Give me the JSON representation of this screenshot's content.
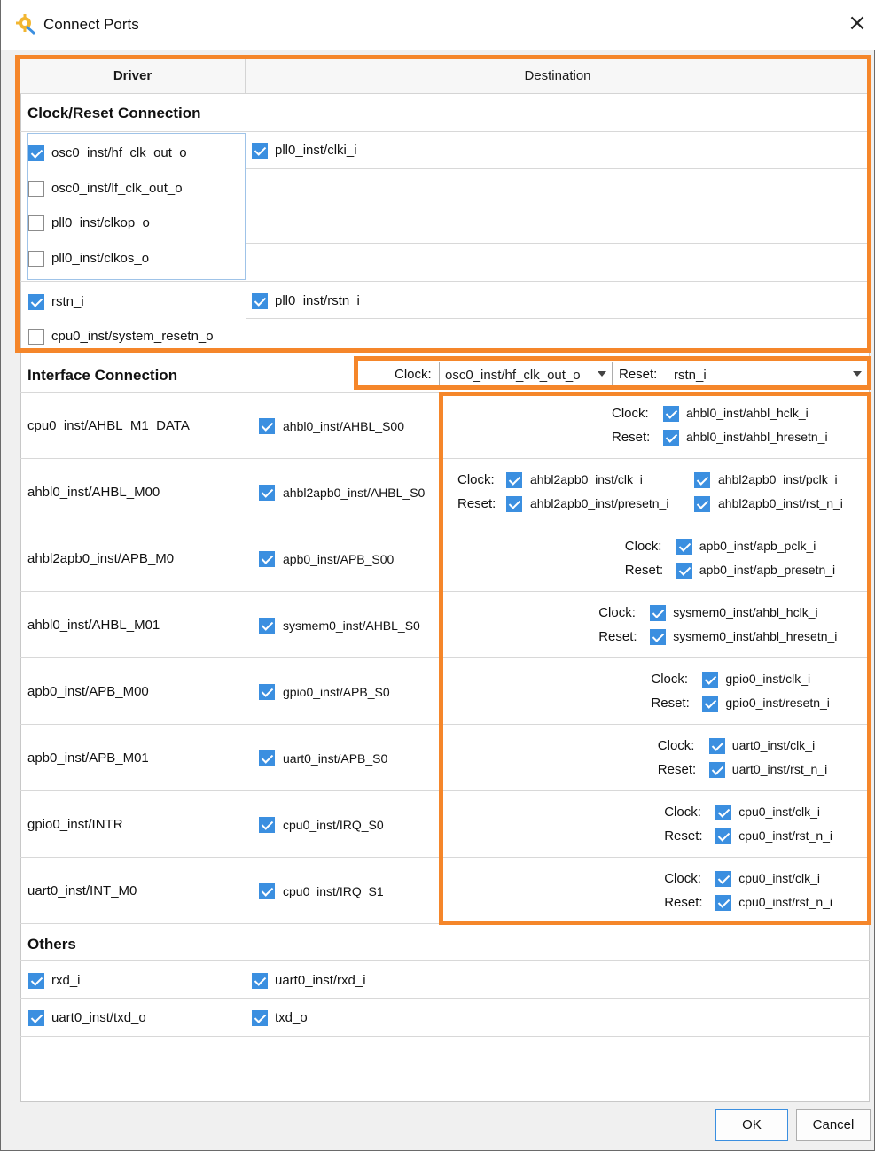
{
  "window": {
    "title": "Connect Ports",
    "close_glyph": "×"
  },
  "table": {
    "driver_header": "Driver",
    "destination_header": "Destination"
  },
  "clock_reset": {
    "title": "Clock/Reset Connection",
    "clock_drivers": [
      {
        "label": "osc0_inst/hf_clk_out_o",
        "checked": true
      },
      {
        "label": "osc0_inst/lf_clk_out_o",
        "checked": false
      },
      {
        "label": "pll0_inst/clkop_o",
        "checked": false
      },
      {
        "label": "pll0_inst/clkos_o",
        "checked": false
      }
    ],
    "clock_destination": {
      "label": "pll0_inst/clki_i",
      "checked": true
    },
    "reset_drivers": [
      {
        "label": "rstn_i",
        "checked": true
      },
      {
        "label": "cpu0_inst/system_resetn_o",
        "checked": false
      }
    ],
    "reset_destination": {
      "label": "pll0_inst/rstn_i",
      "checked": true
    }
  },
  "interface": {
    "title": "Interface Connection",
    "clock_label": "Clock:",
    "clock_value": "osc0_inst/hf_clk_out_o",
    "reset_label": "Reset:",
    "reset_value": "rstn_i",
    "rows": [
      {
        "driver": "cpu0_inst/AHBL_M1_DATA",
        "dest": "ahbl0_inst/AHBL_S00",
        "clocks": [
          "ahbl0_inst/ahbl_hclk_i"
        ],
        "resets": [
          "ahbl0_inst/ahbl_hresetn_i"
        ]
      },
      {
        "driver": "ahbl0_inst/AHBL_M00",
        "dest": "ahbl2apb0_inst/AHBL_S0",
        "clocks": [
          "ahbl2apb0_inst/clk_i",
          "ahbl2apb0_inst/pclk_i"
        ],
        "resets": [
          "ahbl2apb0_inst/presetn_i",
          "ahbl2apb0_inst/rst_n_i"
        ]
      },
      {
        "driver": "ahbl2apb0_inst/APB_M0",
        "dest": "apb0_inst/APB_S00",
        "clocks": [
          "apb0_inst/apb_pclk_i"
        ],
        "resets": [
          "apb0_inst/apb_presetn_i"
        ]
      },
      {
        "driver": "ahbl0_inst/AHBL_M01",
        "dest": "sysmem0_inst/AHBL_S0",
        "clocks": [
          "sysmem0_inst/ahbl_hclk_i"
        ],
        "resets": [
          "sysmem0_inst/ahbl_hresetn_i"
        ]
      },
      {
        "driver": "apb0_inst/APB_M00",
        "dest": "gpio0_inst/APB_S0",
        "clocks": [
          "gpio0_inst/clk_i"
        ],
        "resets": [
          "gpio0_inst/resetn_i"
        ]
      },
      {
        "driver": "apb0_inst/APB_M01",
        "dest": "uart0_inst/APB_S0",
        "clocks": [
          "uart0_inst/clk_i"
        ],
        "resets": [
          "uart0_inst/rst_n_i"
        ]
      },
      {
        "driver": "gpio0_inst/INTR",
        "dest": "cpu0_inst/IRQ_S0",
        "clocks": [
          "cpu0_inst/clk_i"
        ],
        "resets": [
          "cpu0_inst/rst_n_i"
        ]
      },
      {
        "driver": "uart0_inst/INT_M0",
        "dest": "cpu0_inst/IRQ_S1",
        "clocks": [
          "cpu0_inst/clk_i"
        ],
        "resets": [
          "cpu0_inst/rst_n_i"
        ]
      }
    ]
  },
  "others": {
    "title": "Others",
    "rows": [
      {
        "driver": "rxd_i",
        "dest": "uart0_inst/rxd_i"
      },
      {
        "driver": "uart0_inst/txd_o",
        "dest": "txd_o"
      }
    ]
  },
  "buttons": {
    "ok": "OK",
    "cancel": "Cancel"
  },
  "colors": {
    "highlight": "#f5862a",
    "checkbox": "#3b8fe0"
  }
}
